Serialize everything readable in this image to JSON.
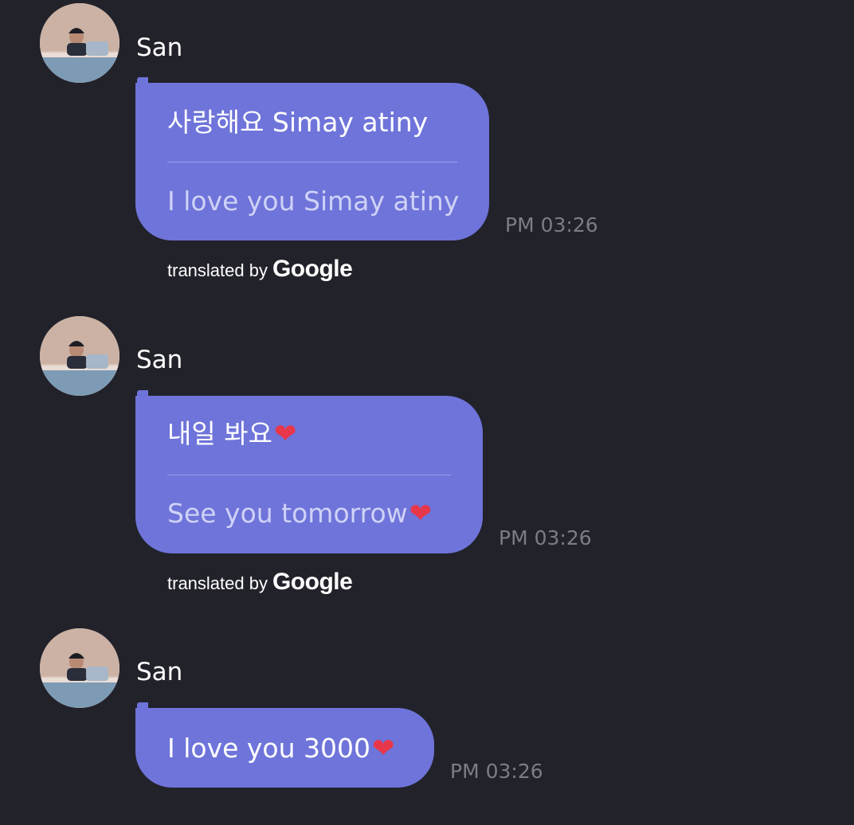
{
  "messages": [
    {
      "sender": "San",
      "original": "사랑해요 Simay atiny",
      "translation": "I love you Simay atiny",
      "time": "PM 03:26",
      "attribution_prefix": "translated by",
      "attribution_brand": "Google"
    },
    {
      "sender": "San",
      "original": "내일 봐요",
      "translation": "See you tomorrow",
      "time": "PM 03:26",
      "attribution_prefix": "translated by",
      "attribution_brand": "Google"
    },
    {
      "sender": "San",
      "original": "I love you 3000",
      "time": "PM 03:26"
    }
  ],
  "heart_symbol": "❤",
  "colors": {
    "background": "#22222b",
    "bubble": "#6e74d9",
    "heart": "#e8374a",
    "timestamp": "#7c7c86"
  }
}
